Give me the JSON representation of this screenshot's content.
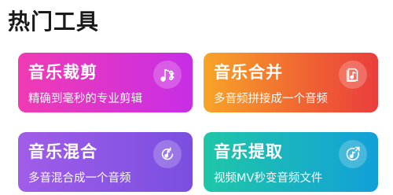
{
  "section": {
    "title": "热门工具"
  },
  "tools": [
    {
      "title": "音乐裁剪",
      "subtitle": "精确到毫秒的专业剪辑",
      "icon": "music-scissors-icon"
    },
    {
      "title": "音乐合并",
      "subtitle": "多音频拼接成一个音频",
      "icon": "music-document-icon"
    },
    {
      "title": "音乐混合",
      "subtitle": "多音混合成一个音频",
      "icon": "music-mix-icon"
    },
    {
      "title": "音乐提取",
      "subtitle": "视频MV秒变音频文件",
      "icon": "music-extract-icon"
    }
  ],
  "colors": {
    "trim": [
      "#f03bb3",
      "#c82ee6"
    ],
    "merge": [
      "#f8a428",
      "#ea3e3d"
    ],
    "mix": [
      "#a05de8",
      "#7a4fe0"
    ],
    "extract": [
      "#1fc6a8",
      "#12a0d8"
    ]
  }
}
